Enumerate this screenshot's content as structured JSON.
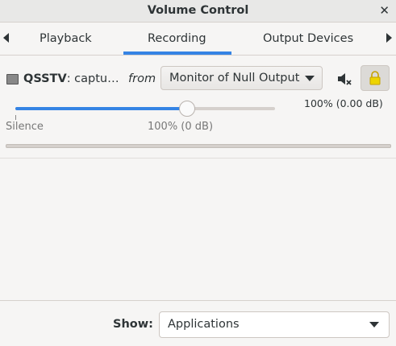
{
  "window": {
    "title": "Volume Control"
  },
  "tabs": [
    {
      "label": "Playback"
    },
    {
      "label": "Recording",
      "active": true
    },
    {
      "label": "Output Devices"
    }
  ],
  "stream": {
    "app_name": "QSSTV",
    "app_desc": ": captu…",
    "from_label": "from",
    "device": "Monitor of Null Output",
    "volume_text": "100% (0.00 dB)",
    "volume_fraction": 0.66,
    "scale_min_label": "Silence",
    "scale_mid_label": "100% (0 dB)",
    "peak_level": 0.0
  },
  "footer": {
    "show_label": "Show:",
    "show_value": "Applications"
  },
  "colors": {
    "accent": "#3584e4",
    "background": "#f6f5f4"
  },
  "icons": {
    "mute": "speaker-muted-icon",
    "lock": "lock-icon",
    "app": "application-icon"
  }
}
